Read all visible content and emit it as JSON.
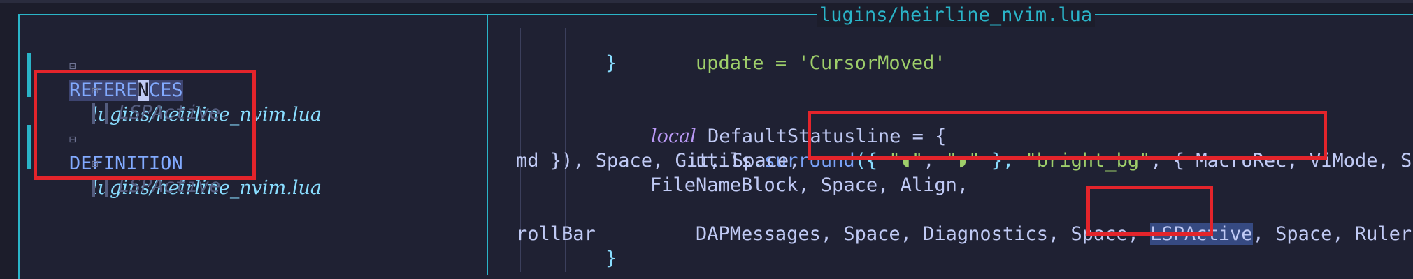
{
  "window": {
    "title": "lugins/heirline_nvim.lua"
  },
  "references_panel": {
    "fold_icon": "⊟",
    "sections": [
      {
        "heading_a": "REFERE",
        "heading_cursor": "N",
        "heading_b": "CES",
        "file": "lugins/heirline_nvim.lua",
        "symbol": "LSPActive"
      },
      {
        "heading": "DEFINITION",
        "file": "lugins/heirline_nvim.lua",
        "symbol": "LSPActive"
      }
    ]
  },
  "code": {
    "l1": {
      "text": "update = 'CursorMoved'"
    },
    "l2": {
      "text": "}"
    },
    "l3": {
      "kw": "local",
      "name": " DefaultStatusline = {"
    },
    "l4": {
      "a": "utils",
      "b": ".",
      "c": "surround",
      "d": "({ ",
      "s1": "\"",
      "i1": "◖",
      "s1e": "\"",
      "comma": ", ",
      "s2": "\"",
      "i2": "◗",
      "s2e": "\"",
      "e": " }, ",
      "s3": "\"bright_bg\"",
      "f": ", { MacroRec, ViMode, ShowC"
    },
    "l5": {
      "text": "md }), Space, Git, Space,"
    },
    "l6": {
      "text": "FileNameBlock, Space, Align,"
    },
    "l7": {
      "pre": "DAPMessages, Space, Diagnostics, Space, ",
      "sel": "LSPActive",
      "post": ", Space, Ruler, Sc"
    },
    "l8": {
      "text": "rollBar"
    },
    "l9": {
      "text": "}"
    }
  },
  "colors": {
    "border": "#2ab4c8",
    "highlight_box": "#e3242b",
    "background": "#1c1d2b"
  }
}
